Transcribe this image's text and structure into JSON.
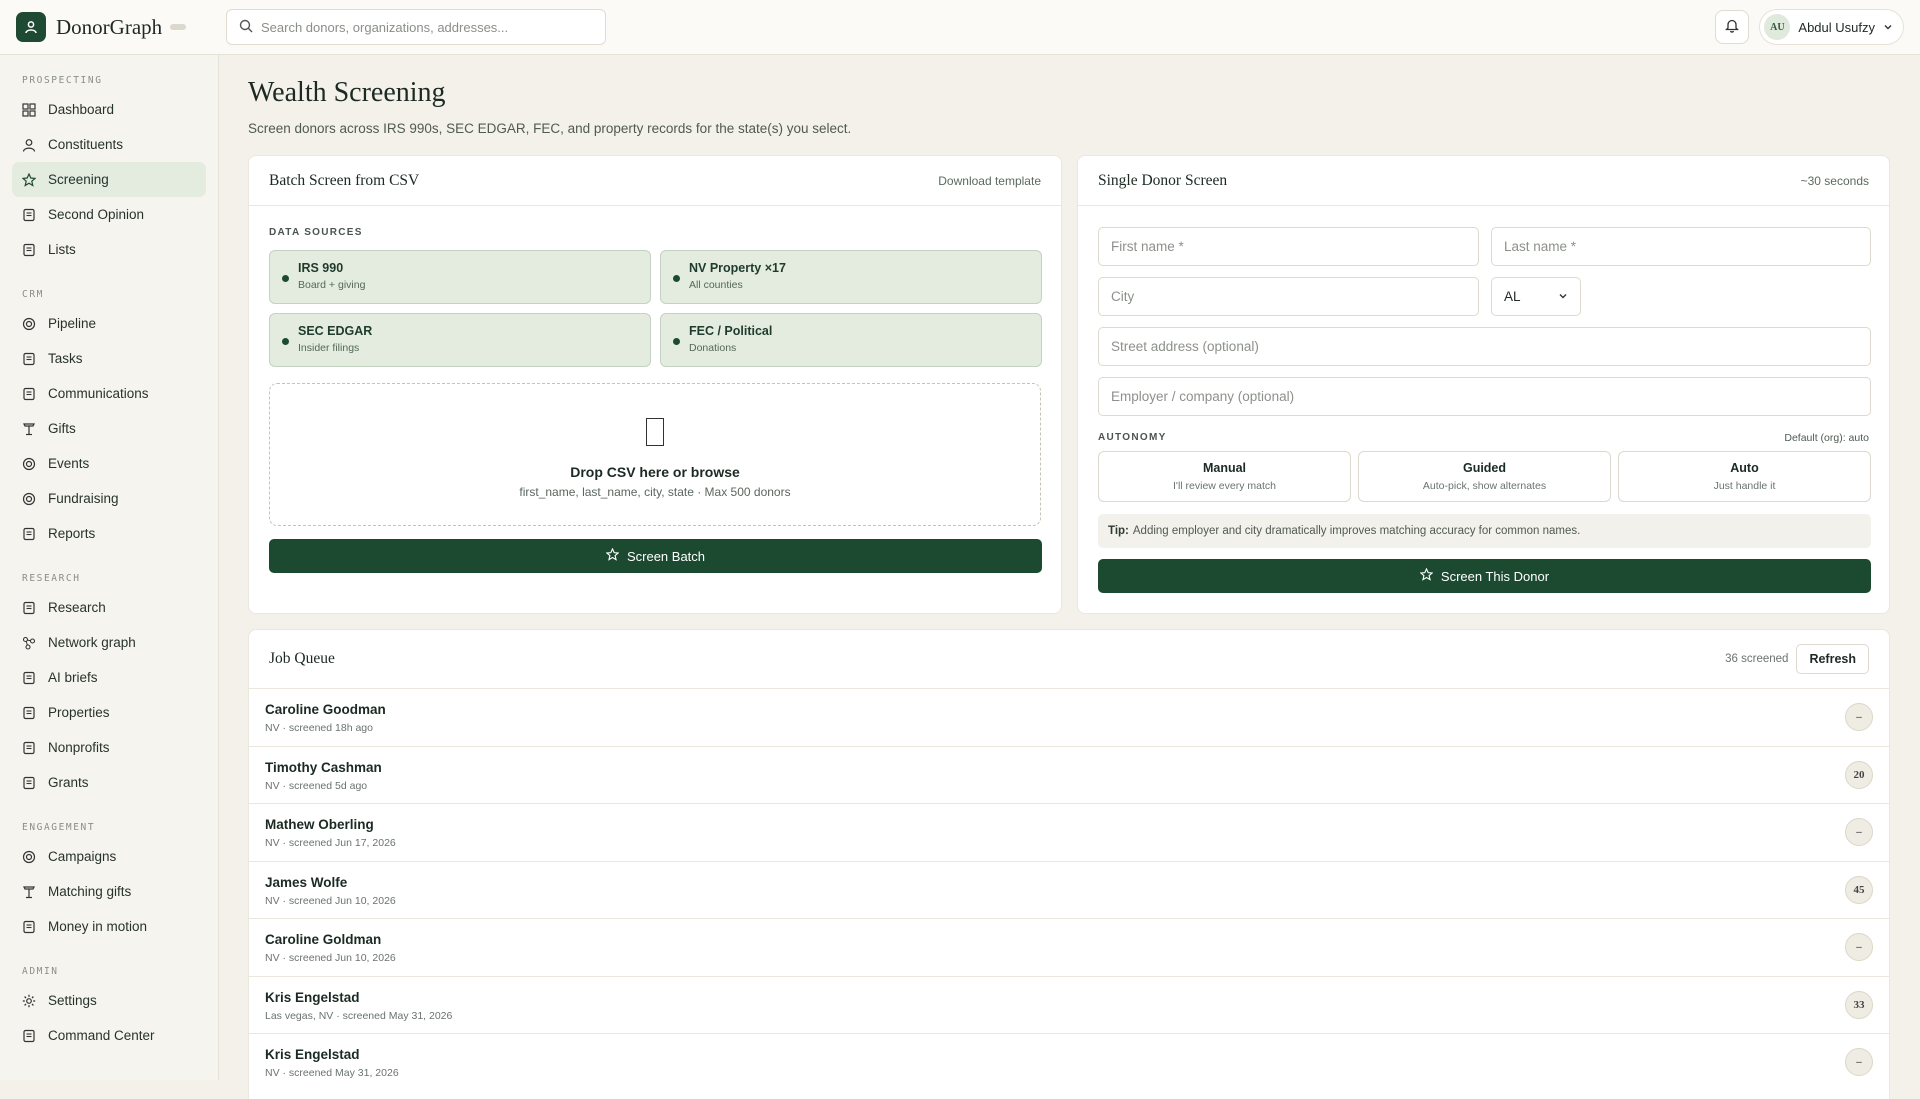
{
  "brand": {
    "name": "DonorGraph"
  },
  "search": {
    "placeholder": "Search donors, organizations, addresses..."
  },
  "user": {
    "initials": "AU",
    "name": "Abdul Usufzy"
  },
  "sidebar": {
    "sections": [
      {
        "label": "PROSPECTING",
        "items": [
          {
            "label": "Dashboard",
            "icon": "grid-icon"
          },
          {
            "label": "Constituents",
            "icon": "person-icon"
          },
          {
            "label": "Screening",
            "icon": "star-icon",
            "active": true
          },
          {
            "label": "Second Opinion",
            "icon": "doc-icon"
          },
          {
            "label": "Lists",
            "icon": "doc-icon"
          }
        ]
      },
      {
        "label": "CRM",
        "items": [
          {
            "label": "Pipeline",
            "icon": "target-icon"
          },
          {
            "label": "Tasks",
            "icon": "doc-icon"
          },
          {
            "label": "Communications",
            "icon": "doc-icon"
          },
          {
            "label": "Gifts",
            "icon": "trophy-icon"
          },
          {
            "label": "Events",
            "icon": "target-icon"
          },
          {
            "label": "Fundraising",
            "icon": "target-icon"
          },
          {
            "label": "Reports",
            "icon": "doc-icon"
          }
        ]
      },
      {
        "label": "RESEARCH",
        "items": [
          {
            "label": "Research",
            "icon": "doc-icon"
          },
          {
            "label": "Network graph",
            "icon": "network-icon"
          },
          {
            "label": "AI briefs",
            "icon": "doc-icon"
          },
          {
            "label": "Properties",
            "icon": "doc-icon"
          },
          {
            "label": "Nonprofits",
            "icon": "doc-icon"
          },
          {
            "label": "Grants",
            "icon": "doc-icon"
          }
        ]
      },
      {
        "label": "ENGAGEMENT",
        "items": [
          {
            "label": "Campaigns",
            "icon": "target-icon"
          },
          {
            "label": "Matching gifts",
            "icon": "trophy-icon"
          },
          {
            "label": "Money in motion",
            "icon": "doc-icon"
          }
        ]
      },
      {
        "label": "ADMIN",
        "items": [
          {
            "label": "Settings",
            "icon": "gear-icon"
          },
          {
            "label": "Command Center",
            "icon": "doc-icon"
          }
        ]
      }
    ]
  },
  "page": {
    "title": "Wealth Screening",
    "subtitle": "Screen donors across IRS 990s, SEC EDGAR, FEC, and property records for the state(s) you select."
  },
  "batch": {
    "title": "Batch Screen from CSV",
    "download_label": "Download template",
    "sources_label": "DATA SOURCES",
    "sources": [
      {
        "title": "IRS 990",
        "sub": "Board + giving"
      },
      {
        "title": "NV Property ×17",
        "sub": "All counties"
      },
      {
        "title": "SEC EDGAR",
        "sub": "Insider filings"
      },
      {
        "title": "FEC / Political",
        "sub": "Donations"
      }
    ],
    "drop_title": "Drop CSV here or browse",
    "drop_sub": "first_name, last_name, city, state · Max 500 donors",
    "button_label": "Screen Batch"
  },
  "single": {
    "title": "Single Donor Screen",
    "eta": "~30 seconds",
    "first_name_placeholder": "First name *",
    "last_name_placeholder": "Last name *",
    "city_placeholder": "City",
    "state_value": "AL",
    "street_placeholder": "Street address (optional)",
    "employer_placeholder": "Employer / company (optional)",
    "autonomy_label": "AUTONOMY",
    "autonomy_default": "Default (org): auto",
    "autonomy_options": [
      {
        "title": "Manual",
        "sub": "I'll review every match"
      },
      {
        "title": "Guided",
        "sub": "Auto-pick, show alternates"
      },
      {
        "title": "Auto",
        "sub": "Just handle it"
      }
    ],
    "tip_label": "Tip:",
    "tip_text": "Adding employer and city dramatically improves matching accuracy for common names.",
    "button_label": "Screen This Donor"
  },
  "queue": {
    "title": "Job Queue",
    "count": "36 screened",
    "refresh_label": "Refresh",
    "rows": [
      {
        "name": "Caroline Goodman",
        "meta": "NV · screened 18h ago",
        "score": "–"
      },
      {
        "name": "Timothy Cashman",
        "meta": "NV · screened 5d ago",
        "score": "20"
      },
      {
        "name": "Mathew Oberling",
        "meta": "NV · screened Jun 17, 2026",
        "score": "–"
      },
      {
        "name": "James Wolfe",
        "meta": "NV · screened Jun 10, 2026",
        "score": "45"
      },
      {
        "name": "Caroline Goldman",
        "meta": "NV · screened Jun 10, 2026",
        "score": "–"
      },
      {
        "name": "Kris Engelstad",
        "meta": "Las vegas, NV · screened May 31, 2026",
        "score": "33"
      },
      {
        "name": "Kris Engelstad",
        "meta": "NV · screened May 31, 2026",
        "score": "–"
      }
    ]
  },
  "colors": {
    "accent": "#1c4a30",
    "source_bg": "#e3ecdf",
    "page_bg": "#f4f1ea"
  }
}
